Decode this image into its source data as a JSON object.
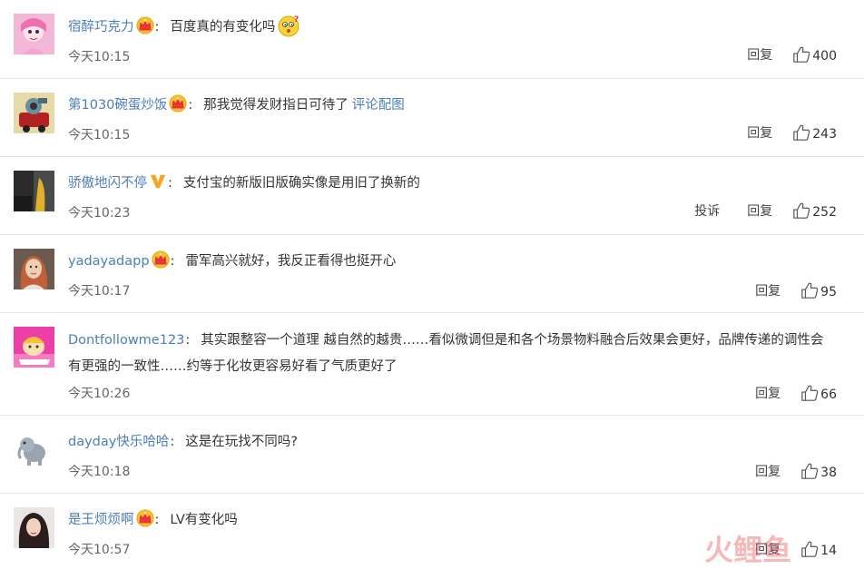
{
  "ui": {
    "reply_label": "回复",
    "report_label": "投诉"
  },
  "watermark": {
    "text": "火鲤鱼"
  },
  "comments": [
    {
      "user": "宿醉巧克力",
      "badge": "crown",
      "content": "百度真的有变化吗",
      "time": "今天10:15",
      "likes": "400",
      "report": false,
      "emoji": "thinking-face"
    },
    {
      "user": "第1030碗蛋炒饭",
      "badge": "crown",
      "content": "那我觉得发财指日可待了",
      "link": "评论配图",
      "time": "今天10:15",
      "likes": "243",
      "report": false
    },
    {
      "user": "骄傲地闪不停",
      "badge": "v",
      "content": "支付宝的新版旧版确实像是用旧了换新的",
      "time": "今天10:23",
      "likes": "252",
      "report": true
    },
    {
      "user": "yadayadapp",
      "badge": "crown",
      "content": "雷军高兴就好，我反正看得也挺开心",
      "time": "今天10:17",
      "likes": "95",
      "report": false
    },
    {
      "user": "Dontfollowme123",
      "badge": "none",
      "content_line1": "其实跟整容一个道理 越自然的越贵……看似微调但是和各个场景物料融合后效果会更好，品牌传递的调性会",
      "content_line2": "有更强的一致性……约等于化妆更容易好看了气质更好了",
      "time": "今天10:26",
      "likes": "66",
      "report": false
    },
    {
      "user": "dayday快乐哈哈",
      "badge": "none",
      "content": "这是在玩找不同吗?",
      "time": "今天10:18",
      "likes": "38",
      "report": false
    },
    {
      "user": "是王烦烦啊",
      "badge": "crown",
      "content": "LV有变化吗",
      "time": "今天10:57",
      "likes": "14",
      "report": false
    }
  ]
}
